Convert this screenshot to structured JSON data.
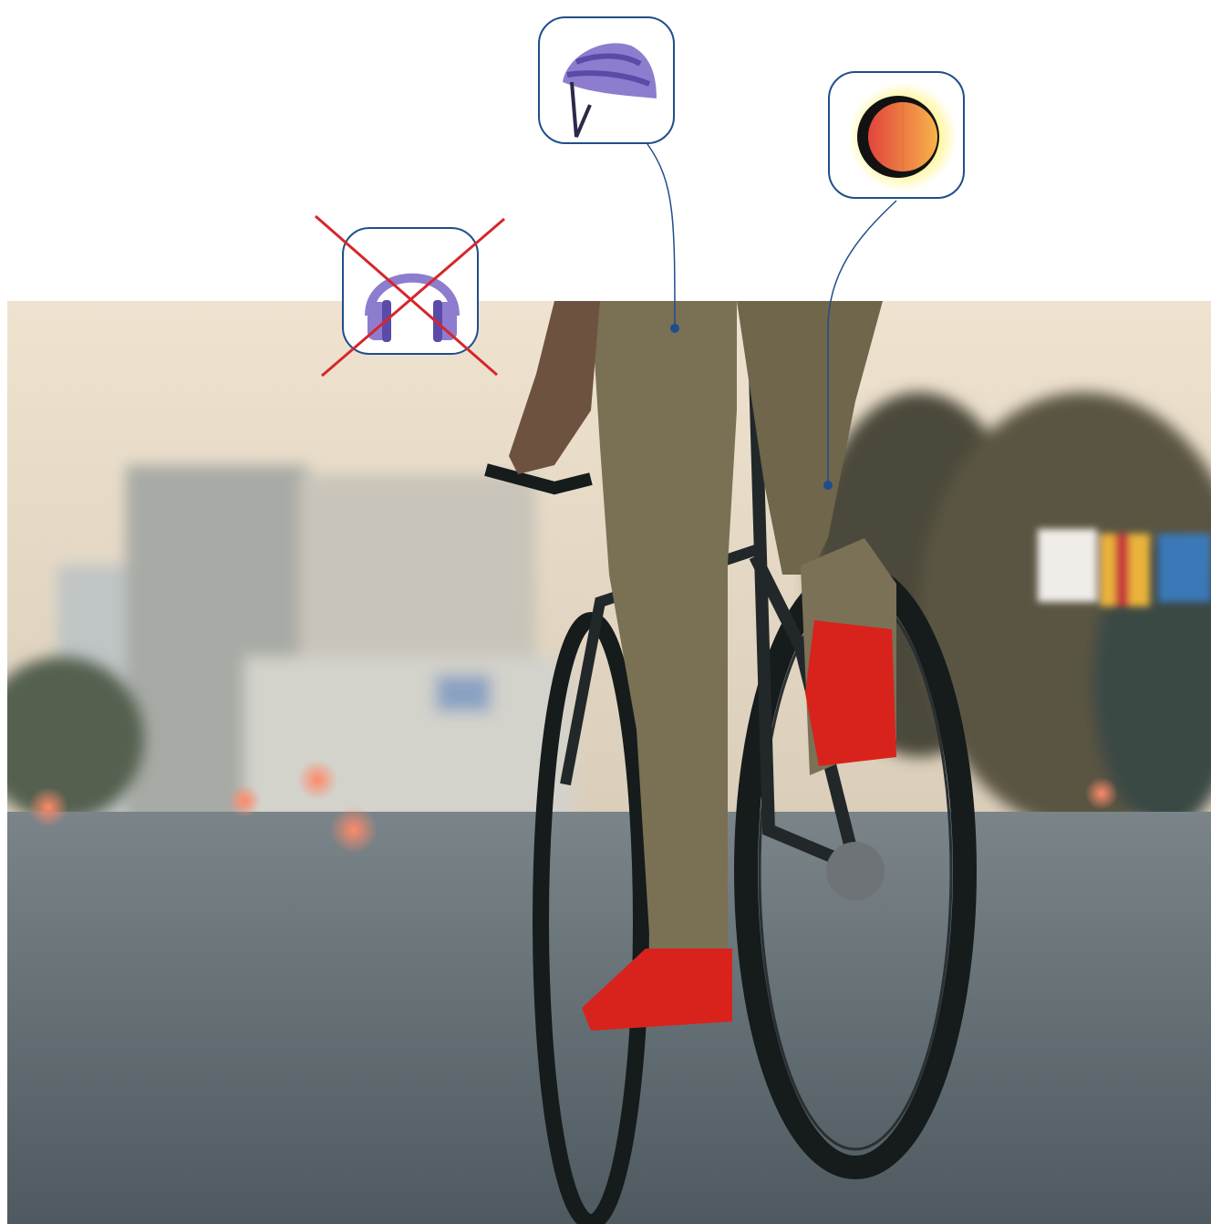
{
  "scene": {
    "subject": "cyclist-riding-road",
    "colors": {
      "sky": "#e9ddcc",
      "road": "#5f6b72",
      "trousers": "#7a7054",
      "shoes": "#d8231d",
      "bike": "#1d2326",
      "callout_line": "#1f4e8c",
      "badge_border": "#1f4e8c",
      "headphones": "#8e7ccf",
      "helmet": "#8e7ccf",
      "light": "#f08a3c",
      "cross": "#d6262b"
    }
  },
  "callouts": [
    {
      "icon": "helmet-icon",
      "meaning": "wear-helmet"
    },
    {
      "icon": "bike-light-icon",
      "meaning": "use-light"
    },
    {
      "icon": "headphones-icon",
      "meaning": "no-headphones",
      "crossed_out": true
    }
  ]
}
